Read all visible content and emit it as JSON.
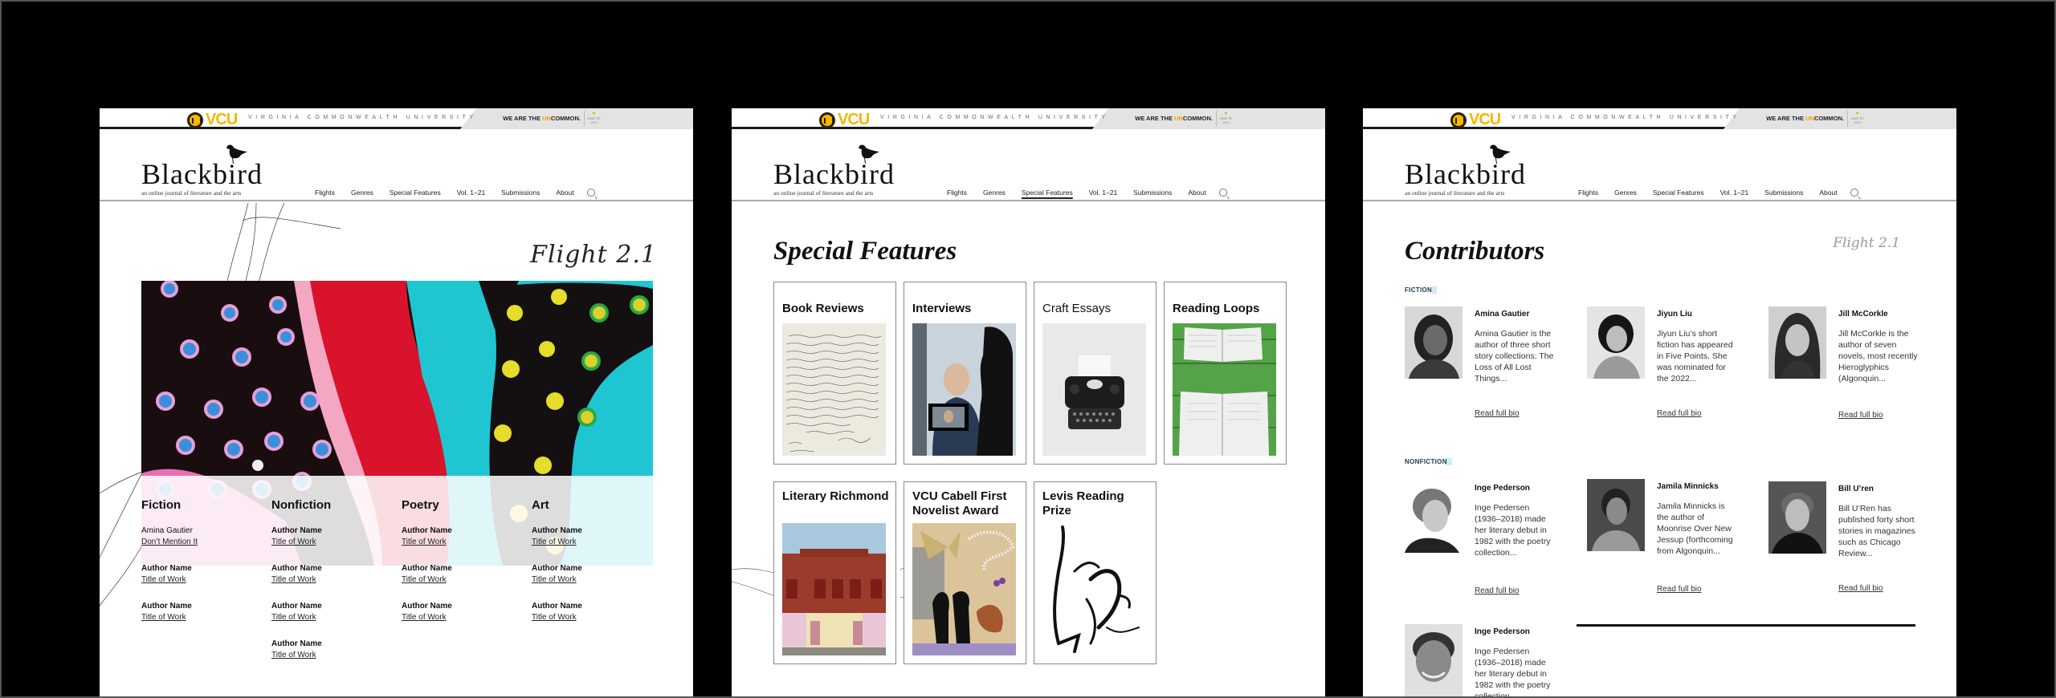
{
  "vcu_bar": {
    "logo_text": "VCU",
    "university": "VIRGINIA COMMONWEALTH UNIVERSITY",
    "tagline_pre": "WE ARE THE ",
    "tagline_un": "UN",
    "tagline_post": "COMMON.",
    "give": "GIVE TO VCU"
  },
  "site": {
    "name": "Blackbird",
    "tagline": "an online journal of literature and the arts",
    "nav": [
      "Flights",
      "Genres",
      "Special Features",
      "Vol. 1–21",
      "Submissions",
      "About"
    ]
  },
  "panel1": {
    "flight_label": "Flight 2.1",
    "genres": [
      {
        "heading": "Fiction",
        "works": [
          {
            "author": "Amina Gautier",
            "title": "Don’t Mention It"
          },
          {
            "author": "Author Name",
            "title": "Title of Work"
          },
          {
            "author": "Author Name",
            "title": "Title of Work"
          }
        ]
      },
      {
        "heading": "Nonfiction",
        "works": [
          {
            "author": "Author Name",
            "title": "Title of Work"
          },
          {
            "author": "Author Name",
            "title": "Title of Work"
          },
          {
            "author": "Author Name",
            "title": "Title of Work"
          },
          {
            "author": "Author Name",
            "title": "Title of Work"
          }
        ]
      },
      {
        "heading": "Poetry",
        "works": [
          {
            "author": "Author Name",
            "title": "Title of Work"
          },
          {
            "author": "Author Name",
            "title": "Title of Work"
          },
          {
            "author": "Author Name",
            "title": "Title of Work"
          }
        ]
      },
      {
        "heading": "Art",
        "works": [
          {
            "author": "Author Name",
            "title": "Title of Work"
          },
          {
            "author": "Author Name",
            "title": "Title of Work"
          },
          {
            "author": "Author Name",
            "title": "Title of Work"
          }
        ]
      }
    ]
  },
  "panel2": {
    "active_nav": "Special Features",
    "title": "Special Features",
    "features": [
      {
        "label": "Book Reviews",
        "image": "handwritten-letter"
      },
      {
        "label": "Interviews",
        "image": "camera-interview"
      },
      {
        "label": "Craft Essays",
        "image": "typewriter"
      },
      {
        "label": "Reading Loops",
        "image": "open-books"
      },
      {
        "label": "Literary Richmond",
        "image": "brick-building"
      },
      {
        "label": "VCU Cabell First Novelist Award",
        "image": "collage"
      },
      {
        "label": "Levis Reading Prize",
        "image": "ink-portrait"
      }
    ]
  },
  "panel3": {
    "title": "Contributors",
    "flight_label": "Flight 2.1",
    "read_more": "Read full bio",
    "sections": [
      {
        "label": "FICTION",
        "contributors": [
          {
            "name": "Amina Gautier",
            "bio": "Amina Gautier is the author of three short story collections: The Loss of All Lost Things..."
          },
          {
            "name": "Jiyun Liu",
            "bio": "Jiyun Liu’s short fiction has appeared in Five Points. She was nominated for the 2022..."
          },
          {
            "name": "Jill McCorkle",
            "bio": "Jill McCorkle is the author of seven novels, most recently Hieroglyphics (Algonquin..."
          }
        ]
      },
      {
        "label": "NONFICTION",
        "contributors": [
          {
            "name": "Inge Pederson",
            "bio": "Inge Pedersen (1936–2018) made her literary debut in 1982 with the poetry collection..."
          },
          {
            "name": "Jamila Minnicks",
            "bio": "Jamila Minnicks is the author of Moonrise Over New Jessup (forthcoming from Algonquin..."
          },
          {
            "name": "Bill U’ren",
            "bio": "Bill U’Ren has published forty short stories in magazines such as Chicago Review..."
          },
          {
            "name": "Inge Pederson",
            "bio": "Inge Pedersen (1936–2018) made her literary debut in 1982 with the poetry collection..."
          }
        ]
      }
    ]
  },
  "colors": {
    "vcu_gold": "#f5b800",
    "uncommon_orange": "#f5a200",
    "section_highlight": "#c9eef7",
    "background": "#000000"
  }
}
